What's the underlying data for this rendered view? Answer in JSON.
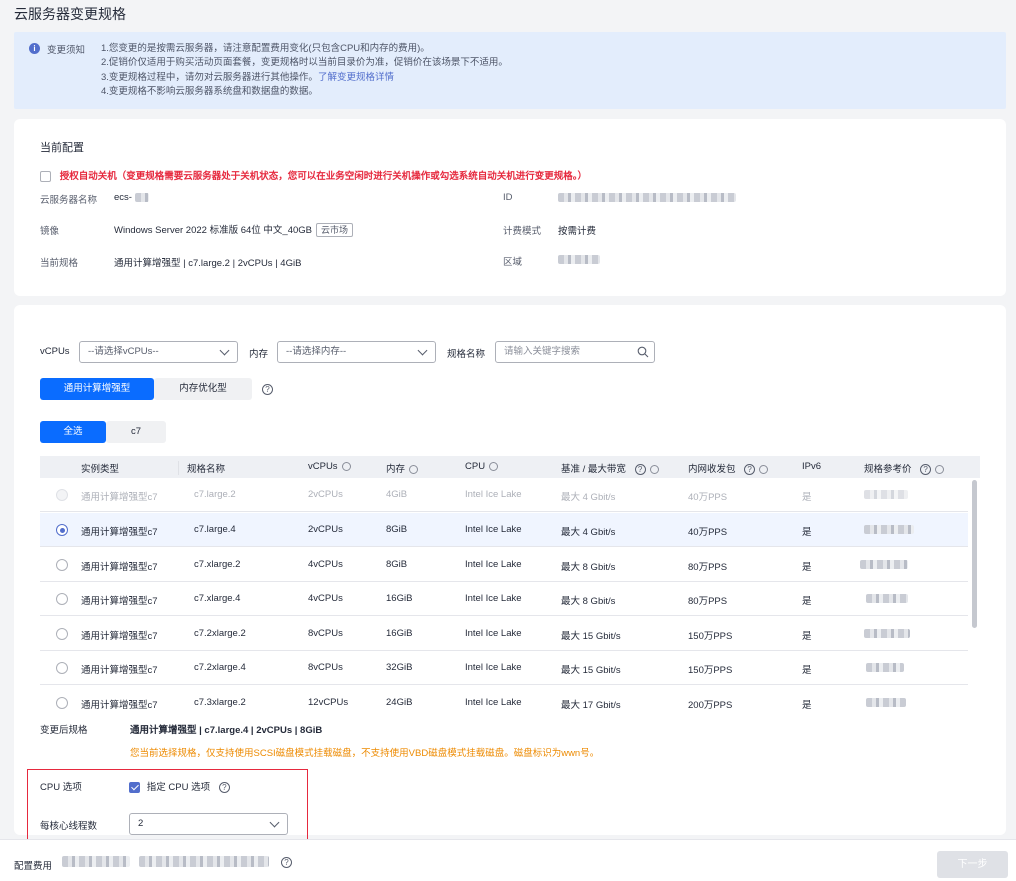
{
  "page": {
    "title": "云服务器变更规格"
  },
  "notice": {
    "label": "变更须知",
    "line1": "1.您变更的是按需云服务器，请注意配置费用变化(只包含CPU和内存的费用)。",
    "line2": "2.促销价仅适用于购买活动页面套餐，变更规格时以当前目录价为准，促销价在该场景下不适用。",
    "line3": "3.变更规格过程中，请勿对云服务器进行其他操作。",
    "line3_link": "了解变更规格详情",
    "line4": "4.变更规格不影响云服务器系统盘和数据盘的数据。"
  },
  "current": {
    "heading": "当前配置",
    "auto_shutdown": "授权自动关机（变更规格需要云服务器处于关机状态，您可以在业务空闲时进行关机操作或勾选系统自动关机进行变更规格。）",
    "name_label": "云服务器名称",
    "name_value": "ecs-",
    "id_label": "ID",
    "image_label": "镜像",
    "image_value": "Windows Server 2022 标准版 64位 中文_40GB",
    "image_tag": "云市场",
    "billing_label": "计费模式",
    "billing_value": "按需计费",
    "spec_label": "当前规格",
    "spec_value": "通用计算增强型 | c7.large.2 | 2vCPUs | 4GiB",
    "region_label": "区域"
  },
  "filters": {
    "vcpu_label": "vCPUs",
    "vcpu_placeholder": "--请选择vCPUs--",
    "mem_label": "内存",
    "mem_placeholder": "--请选择内存--",
    "name_label": "规格名称",
    "search_placeholder": "请输入关键字搜索"
  },
  "type_tabs": [
    {
      "label": "通用计算增强型"
    },
    {
      "label": "内存优化型"
    }
  ],
  "family_tabs": [
    {
      "label": "全选"
    },
    {
      "label": "c7"
    }
  ],
  "table": {
    "headers": [
      "实例类型",
      "规格名称",
      "vCPUs",
      "内存",
      "CPU",
      "基准 / 最大带宽",
      "内网收发包",
      "IPv6",
      "规格参考价"
    ],
    "rows": [
      [
        "通用计算增强型c7",
        "c7.large.2",
        "2vCPUs",
        "4GiB",
        "Intel Ice Lake",
        "最大 4 Gbit/s",
        "40万PPS",
        "是"
      ],
      [
        "通用计算增强型c7",
        "c7.large.4",
        "2vCPUs",
        "8GiB",
        "Intel Ice Lake",
        "最大 4 Gbit/s",
        "40万PPS",
        "是"
      ],
      [
        "通用计算增强型c7",
        "c7.xlarge.2",
        "4vCPUs",
        "8GiB",
        "Intel Ice Lake",
        "最大 8 Gbit/s",
        "80万PPS",
        "是"
      ],
      [
        "通用计算增强型c7",
        "c7.xlarge.4",
        "4vCPUs",
        "16GiB",
        "Intel Ice Lake",
        "最大 8 Gbit/s",
        "80万PPS",
        "是"
      ],
      [
        "通用计算增强型c7",
        "c7.2xlarge.2",
        "8vCPUs",
        "16GiB",
        "Intel Ice Lake",
        "最大 15 Gbit/s",
        "150万PPS",
        "是"
      ],
      [
        "通用计算增强型c7",
        "c7.2xlarge.4",
        "8vCPUs",
        "32GiB",
        "Intel Ice Lake",
        "最大 15 Gbit/s",
        "150万PPS",
        "是"
      ],
      [
        "通用计算增强型c7",
        "c7.3xlarge.2",
        "12vCPUs",
        "24GiB",
        "Intel Ice Lake",
        "最大 17 Gbit/s",
        "200万PPS",
        "是"
      ]
    ]
  },
  "after": {
    "label": "变更后规格",
    "value": "通用计算增强型 | c7.large.4 | 2vCPUs | 8GiB",
    "warning": "您当前选择规格，仅支持使用SCSI磁盘模式挂载磁盘，不支持使用VBD磁盘模式挂载磁盘。磁盘标识为wwn号。"
  },
  "cpu_options": {
    "label": "CPU 选项",
    "checkbox_label": "指定 CPU 选项",
    "threads_label": "每核心线程数",
    "threads_value": "2"
  },
  "footer": {
    "fee_label": "配置费用",
    "next_label": "下一步"
  }
}
